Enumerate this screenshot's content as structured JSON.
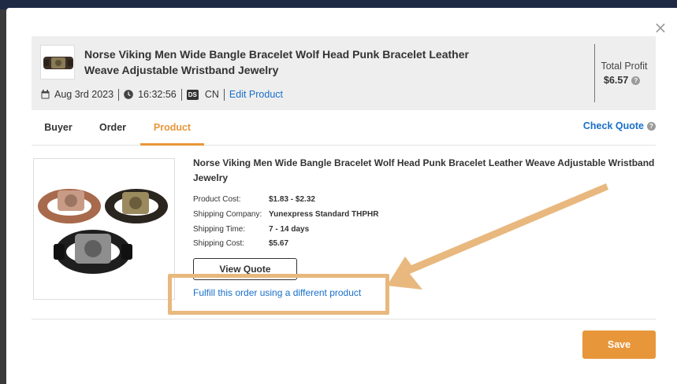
{
  "modal": {
    "close_label": "×"
  },
  "order": {
    "title": "Norse Viking Men Wide Bangle Bracelet Wolf Head Punk Bracelet Leather Weave Adjustable Wristband Jewelry",
    "date": "Aug 3rd 2023",
    "time": "16:32:56",
    "store_badge": "DS",
    "country": "CN",
    "edit_link": "Edit Product",
    "total_profit_label": "Total Profit",
    "total_profit_value": "$6.57"
  },
  "tabs": [
    {
      "label": "Buyer",
      "active": false
    },
    {
      "label": "Order",
      "active": false
    },
    {
      "label": "Product",
      "active": true
    }
  ],
  "check_quote": "Check Quote",
  "product": {
    "title": "Norse Viking Men Wide Bangle Bracelet Wolf Head Punk Bracelet Leather Weave Adjustable Wristband Jewelry",
    "details": [
      {
        "label": "Product Cost:",
        "value": "$1.83 - $2.32"
      },
      {
        "label": "Shipping Company:",
        "value": "Yunexpress Standard THPHR"
      },
      {
        "label": "Shipping Time:",
        "value": "7 - 14 days"
      },
      {
        "label": "Shipping Cost:",
        "value": "$5.67"
      }
    ],
    "view_quote_label": "View Quote",
    "fulfill_link": "Fulfill this order using a different product"
  },
  "footer": {
    "save_label": "Save"
  },
  "icons": {
    "calendar": "calendar-icon",
    "clock": "clock-icon",
    "help": "question-circle-icon",
    "close": "close-icon"
  },
  "colors": {
    "accent": "#e8963a",
    "link": "#1a6fc9",
    "annotation": "#e8b87e"
  }
}
